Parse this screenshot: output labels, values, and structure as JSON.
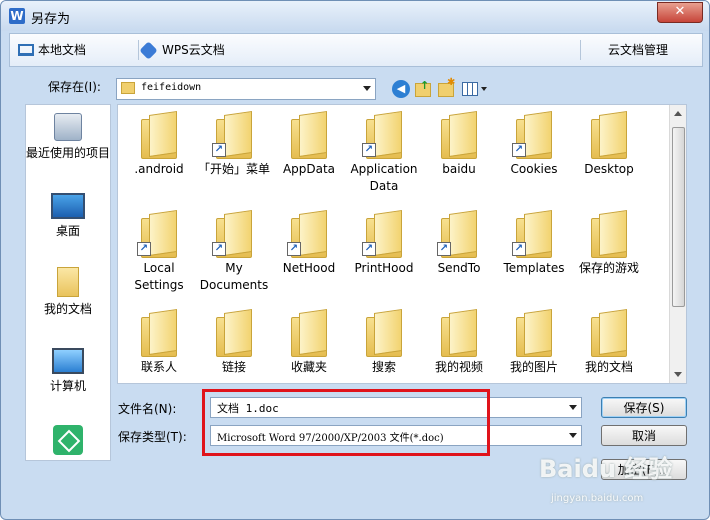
{
  "window": {
    "title": "另存为",
    "app_logo": "W",
    "close": "✕"
  },
  "tabs": {
    "local": "本地文档",
    "wps_cloud": "WPS云文档",
    "cloud_manage": "云文档管理"
  },
  "location": {
    "label": "保存在(I):",
    "value": "feifeidown"
  },
  "toolbar_icons": [
    "back-icon",
    "up-folder-icon",
    "new-folder-icon",
    "view-menu-icon"
  ],
  "places": [
    {
      "label": "最近使用的项目",
      "icon": "recent-items-icon"
    },
    {
      "label": "桌面",
      "icon": "desktop-icon"
    },
    {
      "label": "我的文档",
      "icon": "my-documents-icon"
    },
    {
      "label": "计算机",
      "icon": "computer-icon"
    },
    {
      "label": "",
      "icon": "wps-app-icon"
    }
  ],
  "files": [
    {
      "name": ".android",
      "shortcut": false
    },
    {
      "name": "「开始」菜单",
      "shortcut": true
    },
    {
      "name": "AppData",
      "shortcut": false
    },
    {
      "name": "Application Data",
      "shortcut": true
    },
    {
      "name": "baidu",
      "shortcut": false
    },
    {
      "name": "Cookies",
      "shortcut": true
    },
    {
      "name": "Desktop",
      "shortcut": false
    },
    {
      "name": "Local Settings",
      "shortcut": true
    },
    {
      "name": "My Documents",
      "shortcut": true
    },
    {
      "name": "NetHood",
      "shortcut": true
    },
    {
      "name": "PrintHood",
      "shortcut": true
    },
    {
      "name": "SendTo",
      "shortcut": true
    },
    {
      "name": "Templates",
      "shortcut": true
    },
    {
      "name": "保存的游戏",
      "shortcut": false
    },
    {
      "name": "联系人",
      "shortcut": false
    },
    {
      "name": "链接",
      "shortcut": false
    },
    {
      "name": "收藏夹",
      "shortcut": false
    },
    {
      "name": "搜索",
      "shortcut": false
    },
    {
      "name": "我的视频",
      "shortcut": false
    },
    {
      "name": "我的图片",
      "shortcut": false
    },
    {
      "name": "我的文档",
      "shortcut": false
    }
  ],
  "form": {
    "filename_label": "文件名(N):",
    "filename_value": "文档 1.doc",
    "filetype_label": "保存类型(T):",
    "filetype_value": "Microsoft Word 97/2000/XP/2003 文件(*.doc)"
  },
  "buttons": {
    "save": "保存(S)",
    "cancel": "取消",
    "encrypt": "加密(E)..."
  },
  "watermark": {
    "main": "Baidu 经验",
    "sub": "jingyan.baidu.com"
  },
  "colors": {
    "highlight": "#e0131b",
    "frame": "#c9dcf1"
  }
}
